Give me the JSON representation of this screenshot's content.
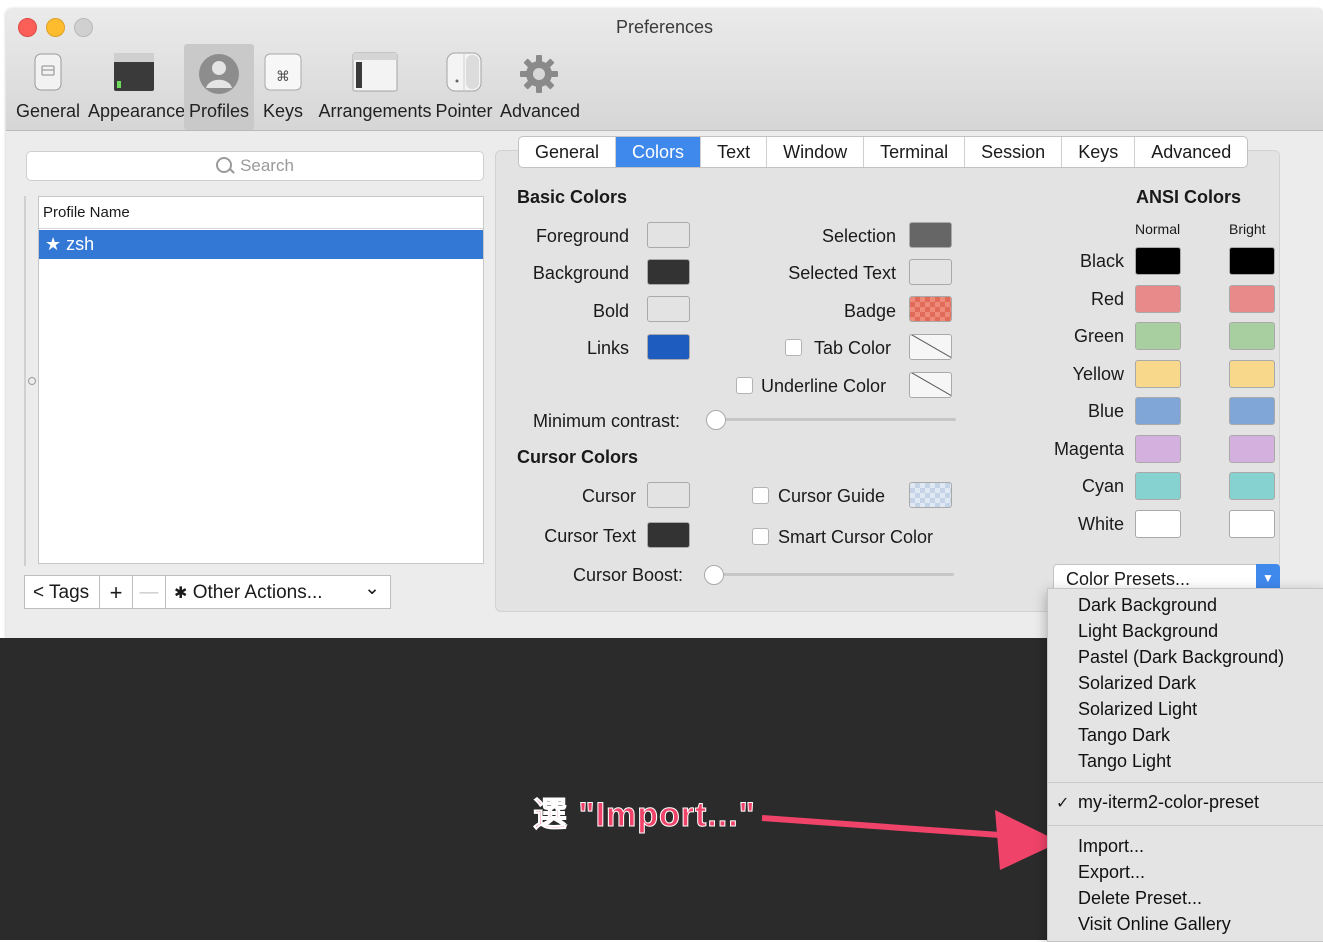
{
  "window": {
    "title": "Preferences"
  },
  "toolbar": {
    "items": [
      {
        "label": "General"
      },
      {
        "label": "Appearance"
      },
      {
        "label": "Profiles"
      },
      {
        "label": "Keys"
      },
      {
        "label": "Arrangements"
      },
      {
        "label": "Pointer"
      },
      {
        "label": "Advanced"
      }
    ],
    "active": "Profiles",
    "keys_glyph": "⌘"
  },
  "sidebar": {
    "search_placeholder": "Search",
    "list_header": "Profile Name",
    "profiles": [
      {
        "name": "★ zsh",
        "selected": true
      }
    ],
    "tags_button": "< Tags",
    "add_button": "+",
    "remove_button": "—",
    "other_actions": "Other Actions...",
    "gear_glyph": "✱",
    "chevron_glyph": "⌄"
  },
  "tabs": [
    "General",
    "Colors",
    "Text",
    "Window",
    "Terminal",
    "Session",
    "Keys",
    "Advanced"
  ],
  "selected_tab": "Colors",
  "basic_colors": {
    "heading": "Basic Colors",
    "foreground": "Foreground",
    "background": "Background",
    "bold": "Bold",
    "links": "Links",
    "selection": "Selection",
    "selected_text": "Selected Text",
    "badge": "Badge",
    "tab_color": "Tab Color",
    "underline_color": "Underline Color",
    "min_contrast": "Minimum contrast:"
  },
  "cursor_colors": {
    "heading": "Cursor Colors",
    "cursor": "Cursor",
    "cursor_text": "Cursor Text",
    "cursor_guide": "Cursor Guide",
    "smart_cursor": "Smart Cursor Color",
    "cursor_boost": "Cursor Boost:"
  },
  "ansi": {
    "heading": "ANSI Colors",
    "normal": "Normal",
    "bright": "Bright",
    "rows": [
      {
        "name": "Black",
        "normal": "#000000",
        "bright": "#000000"
      },
      {
        "name": "Red",
        "normal": "#e88a89",
        "bright": "#e88a89"
      },
      {
        "name": "Green",
        "normal": "#a8cfa0",
        "bright": "#a8cfa0"
      },
      {
        "name": "Yellow",
        "normal": "#f8d88a",
        "bright": "#f8d88a"
      },
      {
        "name": "Blue",
        "normal": "#80a6d8",
        "bright": "#80a6d8"
      },
      {
        "name": "Magenta",
        "normal": "#d4b0df",
        "bright": "#d4b0df"
      },
      {
        "name": "Cyan",
        "normal": "#86d2d0",
        "bright": "#86d2d0"
      },
      {
        "name": "White",
        "normal": "#ffffff",
        "bright": "#ffffff"
      }
    ]
  },
  "color_presets": {
    "label": "Color Presets...",
    "menu_group1": [
      "Dark Background",
      "Light Background",
      "Pastel (Dark Background)",
      "Solarized Dark",
      "Solarized Light",
      "Tango Dark",
      "Tango Light"
    ],
    "checked_item": "my-iterm2-color-preset",
    "checkmark": "✓",
    "menu_group3": [
      "Import...",
      "Export...",
      "Delete Preset...",
      "Visit Online Gallery"
    ]
  },
  "annotation": {
    "text": "選 \"Import...\""
  },
  "colors": {
    "accent": "#3f88ec",
    "annotation": "#f0436a",
    "links_swatch": "#1f5cc0",
    "dark_swatch": "#333333",
    "selection_swatch": "#666666",
    "light_swatch": "#e3e3e3"
  }
}
